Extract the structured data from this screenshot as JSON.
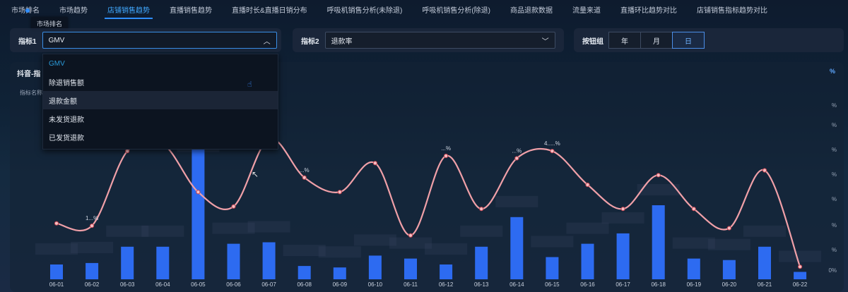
{
  "nav": {
    "tabs": [
      "市场排名",
      "市场趋势",
      "店铺销售趋势",
      "直播销售趋势",
      "直播时长&直播日销分布",
      "呼吸机销售分析(未除退)",
      "呼吸机销售分析(除退)",
      "商品退款数据",
      "流量来道",
      "直播环比趋势对比",
      "店铺销售指标趋势对比"
    ],
    "active_index": 2,
    "tooltip": "市场排名"
  },
  "filters": {
    "metric1_label": "指标1",
    "metric1_value": "GMV",
    "metric2_label": "指标2",
    "metric2_value": "退款率",
    "group_label": "按钮组",
    "group_buttons": [
      "年",
      "月",
      "日"
    ],
    "group_selected": "日"
  },
  "dropdown": {
    "options": [
      "GMV",
      "除退销售额",
      "退款金额",
      "未发货退款",
      "已发货退款"
    ],
    "selected": "GMV",
    "hovered": "退款金额"
  },
  "panel": {
    "title": "抖音-指",
    "subtitle": "指标名称",
    "right_axis_unit": "%"
  },
  "chart_data": {
    "type": "bar",
    "categories": [
      "06-01",
      "06-02",
      "06-03",
      "06-04",
      "06-05",
      "06-06",
      "06-07",
      "06-08",
      "06-09",
      "06-10",
      "06-11",
      "06-12",
      "06-13",
      "06-14",
      "06-15",
      "06-16",
      "06-17",
      "06-18",
      "06-19",
      "06-20",
      "06-21",
      "06-22"
    ],
    "series": [
      {
        "type": "bar",
        "values": [
          10,
          11,
          22,
          22,
          100,
          24,
          25,
          9,
          8,
          16,
          14,
          10,
          22,
          42,
          15,
          24,
          31,
          50,
          14,
          13,
          22,
          5
        ]
      },
      {
        "type": "line",
        "values": [
          20,
          19,
          50,
          53,
          33,
          27,
          55,
          39,
          33,
          45,
          15,
          48,
          26,
          47,
          50,
          36,
          26,
          40,
          26,
          18,
          42,
          2
        ]
      }
    ],
    "right_ticks": [
      "%",
      "%",
      "%",
      "%",
      "%",
      "%",
      "%",
      "0%"
    ],
    "line_labels": [
      "",
      "1...%",
      "",
      "",
      "",
      "",
      "",
      "...%",
      "",
      "",
      "",
      "...%",
      "",
      "...%",
      "4.....%",
      "",
      "",
      "",
      "",
      "",
      "",
      ""
    ],
    "colors": {
      "bar": "#2d6bf1",
      "line": "#f0a0a8",
      "point": "#f5c0c4"
    }
  }
}
